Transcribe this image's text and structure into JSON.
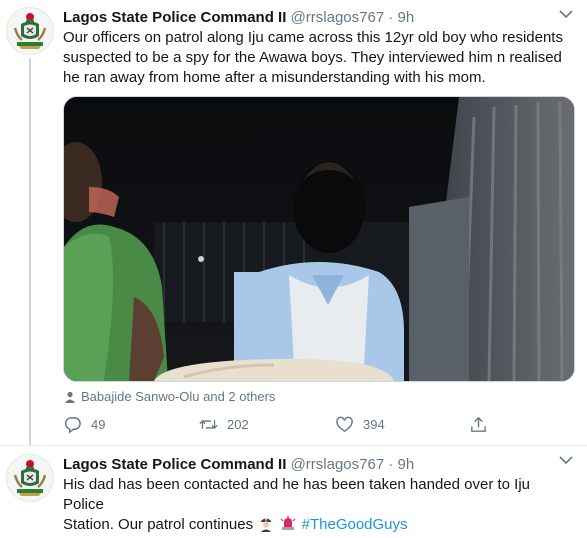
{
  "tweets": [
    {
      "author": {
        "name": "Lagos State Police Command II",
        "handle": "@rrslagos767",
        "avatar_icon": "police-crest-icon"
      },
      "separator": "·",
      "time": "9h",
      "text_lines": [
        "Our officers on patrol along Iju came across this 12yr old boy who residents",
        "suspected to be a spy for the Awawa boys. They interviewed him n realised",
        "he ran away from home after a misunderstanding with his mom."
      ],
      "media_icon": "photo-of-boy-at-night",
      "tagged_users": "Babajide Sanwo-Olu and 2 others",
      "stats": {
        "replies": "49",
        "retweets": "202",
        "likes": "394"
      }
    },
    {
      "author": {
        "name": "Lagos State Police Command II",
        "handle": "@rrslagos767",
        "avatar_icon": "police-crest-icon"
      },
      "separator": "·",
      "time": "9h",
      "text_line1": "His dad has been contacted and he has been taken handed over to Iju Police",
      "text_line2_prefix": "Station. Our patrol continues",
      "emojis": [
        "police-officer-emoji",
        "police-car-light-emoji"
      ],
      "hashtag": "#TheGoodGuys"
    }
  ],
  "colors": {
    "text": "#14171a",
    "secondary": "#657786",
    "link": "#1b95e0",
    "divider": "#e6ecf0",
    "thread_line": "#ccd6dd"
  }
}
